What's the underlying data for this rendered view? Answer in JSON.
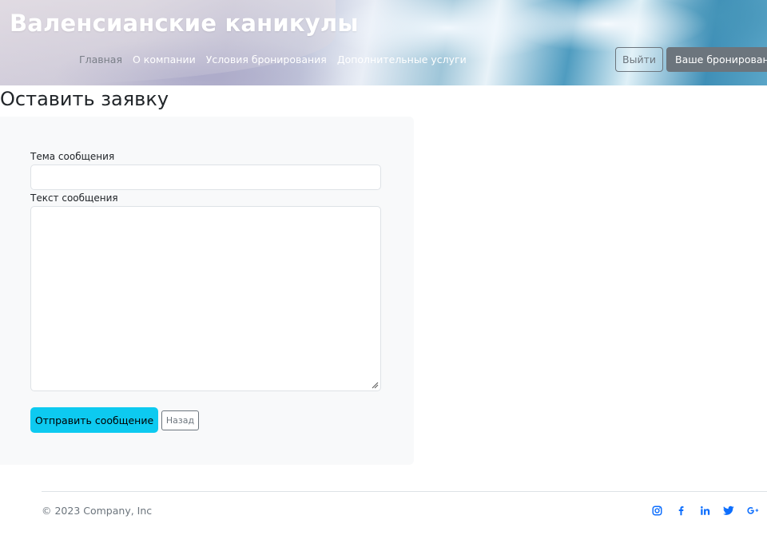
{
  "header": {
    "site_title": "Валенсианские каникулы",
    "nav": [
      {
        "label": "Главная",
        "active": true
      },
      {
        "label": "О компании",
        "active": false
      },
      {
        "label": "Условия бронирования",
        "active": false
      },
      {
        "label": "Дополнительные услуги",
        "active": false
      }
    ],
    "logout_label": "Выйти",
    "booking_label": "Ваше бронирование"
  },
  "page": {
    "title": "Оставить заявку"
  },
  "form": {
    "subject_label": "Тема сообщения",
    "subject_value": "",
    "message_label": "Текст сообщения",
    "message_value": "",
    "send_label": "Отправить сообщение",
    "back_label": "Назад"
  },
  "footer": {
    "copyright": "© 2023 Company, Inc",
    "socials": [
      "instagram-icon",
      "facebook-icon",
      "linkedin-icon",
      "twitter-icon",
      "google-plus-icon"
    ]
  },
  "colors": {
    "accent": "#0dcaf0",
    "secondary": "#6c757d",
    "social": "#0d6efd",
    "form_bg": "#f8f9fa"
  }
}
